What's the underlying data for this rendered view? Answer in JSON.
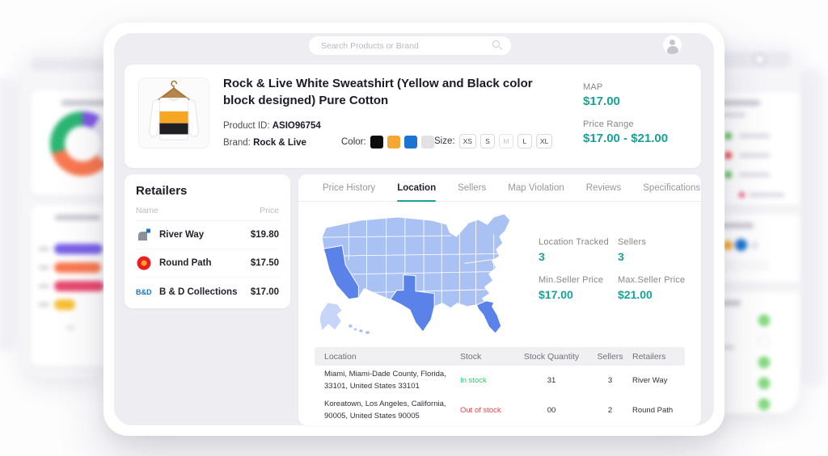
{
  "topbar": {
    "search_placeholder": "Search Products or Brand"
  },
  "product": {
    "title": "Rock & Live White Sweatshirt (Yellow and Black color block designed) Pure Cotton",
    "id_label": "Product ID:",
    "id": "ASIO96754",
    "brand_label": "Brand:",
    "brand": "Rock & Live",
    "color_label": "Color:",
    "colors": [
      "#0d0d0f",
      "#f5a733",
      "#1b74cf",
      "#e2e2e5"
    ],
    "size_label": "Size:",
    "sizes": [
      "XS",
      "S",
      "M",
      "L",
      "XL"
    ],
    "map_label": "MAP",
    "map_value": "$17.00",
    "range_label": "Price Range",
    "range_value": "$17.00 - $21.00"
  },
  "retailers": {
    "title": "Retailers",
    "col_name": "Name",
    "col_price": "Price",
    "items": [
      {
        "name": "River Way",
        "price": "$19.80"
      },
      {
        "name": "Round Path",
        "price": "$17.50"
      },
      {
        "name": "B & D Collections",
        "price": "$17.00",
        "logo_text": "B&D"
      }
    ]
  },
  "tabs": [
    "Price History",
    "Location",
    "Sellers",
    "Map Violation",
    "Reviews",
    "Specifications"
  ],
  "active_tab": "Location",
  "location_panel": {
    "stats": [
      {
        "label": "Location Tracked",
        "value": "3"
      },
      {
        "label": "Sellers",
        "value": "3"
      },
      {
        "label": "Min.Seller Price",
        "value": "$17.00"
      },
      {
        "label": "Max.Seller Price",
        "value": "$21.00"
      }
    ],
    "table": {
      "headers": [
        "Location",
        "Stock",
        "Stock Quantity",
        "Sellers",
        "Retailers"
      ],
      "rows": [
        {
          "location": "Miami, Miami-Dade County, Florida, 33101, United States 33101",
          "stock": "In stock",
          "qty": "31",
          "sellers": "3",
          "retailer": "River Way"
        },
        {
          "location": "Koreatown, Los Angeles, California, 90005, United States 90005",
          "stock": "Out of stock",
          "qty": "00",
          "sellers": "2",
          "retailer": "Round Path"
        }
      ]
    }
  },
  "colors": {
    "accent_teal": "#16a296",
    "in_stock_green": "#27d06e",
    "out_of_stock_red": "#ff3d3d",
    "map_state_blue": "#a9c2f3",
    "map_highlight_blue": "#5b82e8",
    "map_pale_blue": "#c7d6f8"
  }
}
